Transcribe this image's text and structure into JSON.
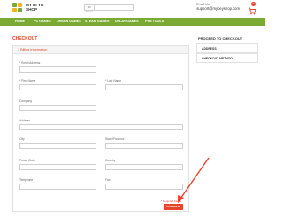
{
  "header": {
    "logo_text_line1": "MY BI YG",
    "logo_text_line2": "SHOP",
    "search_button": "All Games",
    "search_placeholder": "",
    "email_label": "Email Us",
    "email_value": "support@mybeyshop.com",
    "cart_count": "0"
  },
  "nav": {
    "items": [
      "HOME",
      "PC GAMES",
      "ORIGIN GAMES",
      "STEAM GAMES",
      "UPLAY GAMES",
      "PSN TOOLS"
    ]
  },
  "main": {
    "title": "CHECKOUT",
    "section_title": "1 Billing Information",
    "fields": {
      "email_label": "* Email Address",
      "first_name_label": "* First Name",
      "last_name_label": "* Last Name",
      "company_label": "Company",
      "address_label": "Address",
      "city_label": "City",
      "state_label": "State/Province",
      "postal_label": "Postal Code",
      "country_label": "Country",
      "telephone_label": "Telephone",
      "fax_label": "Fax"
    },
    "required_note": "* Required Fields",
    "continue_label": "CONTINUE"
  },
  "sidebar": {
    "title": "PROCEED TO CHECKOUT",
    "items": [
      "ADDRESS",
      "CHECKOUT METHOD"
    ]
  },
  "colors": {
    "accent": "#e8452b",
    "nav": "#7aaa31"
  }
}
